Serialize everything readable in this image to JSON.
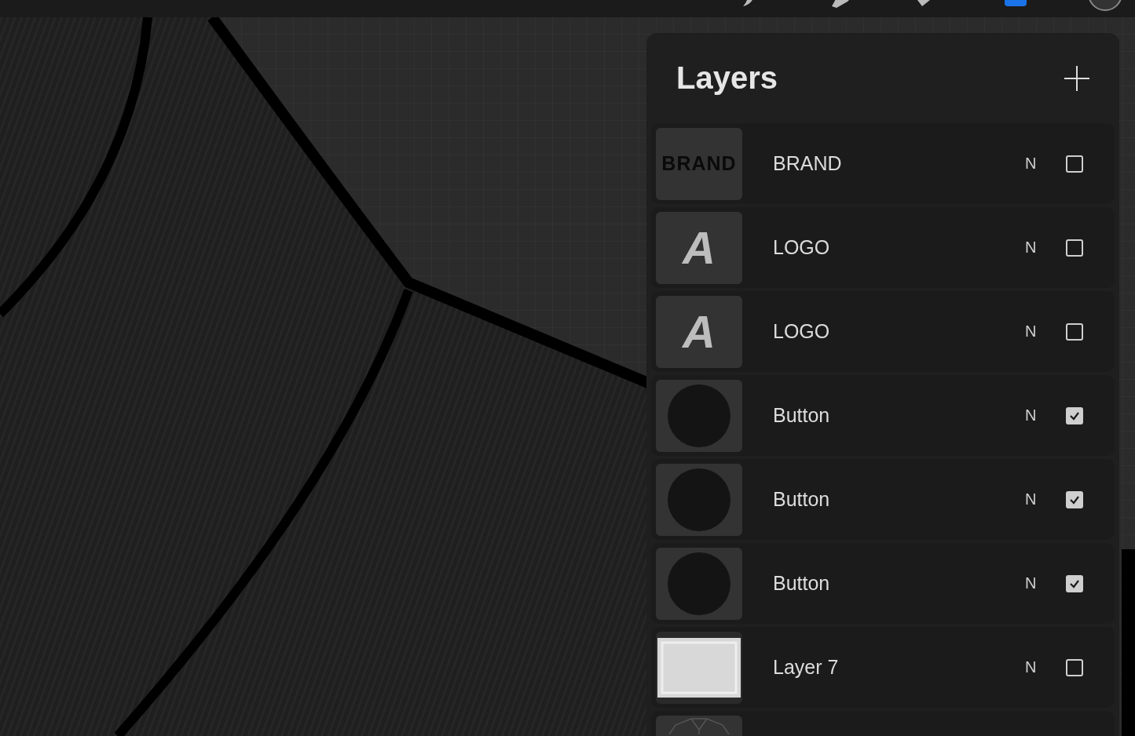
{
  "toolbar": {
    "tools": [
      {
        "kind": "brush",
        "selected": false
      },
      {
        "kind": "smudge",
        "selected": false
      },
      {
        "kind": "eraser",
        "selected": false
      },
      {
        "kind": "layers",
        "selected": true
      },
      {
        "kind": "color",
        "selected": false
      }
    ]
  },
  "layers_panel": {
    "title": "Layers",
    "layers": [
      {
        "name": "BRAND",
        "kind": "text",
        "thumbnail_text": "BRAND",
        "blend_mode": "N",
        "visible": false
      },
      {
        "name": "LOGO",
        "kind": "letter",
        "thumbnail_text": "A",
        "blend_mode": "N",
        "visible": false
      },
      {
        "name": "LOGO",
        "kind": "letter",
        "thumbnail_text": "A",
        "blend_mode": "N",
        "visible": false
      },
      {
        "name": "Button",
        "kind": "circle",
        "blend_mode": "N",
        "visible": true
      },
      {
        "name": "Button",
        "kind": "circle",
        "blend_mode": "N",
        "visible": true
      },
      {
        "name": "Button",
        "kind": "circle",
        "blend_mode": "N",
        "visible": true
      },
      {
        "name": "Layer 7",
        "kind": "frame",
        "blend_mode": "N",
        "visible": false
      },
      {
        "kind": "sketch"
      }
    ]
  }
}
